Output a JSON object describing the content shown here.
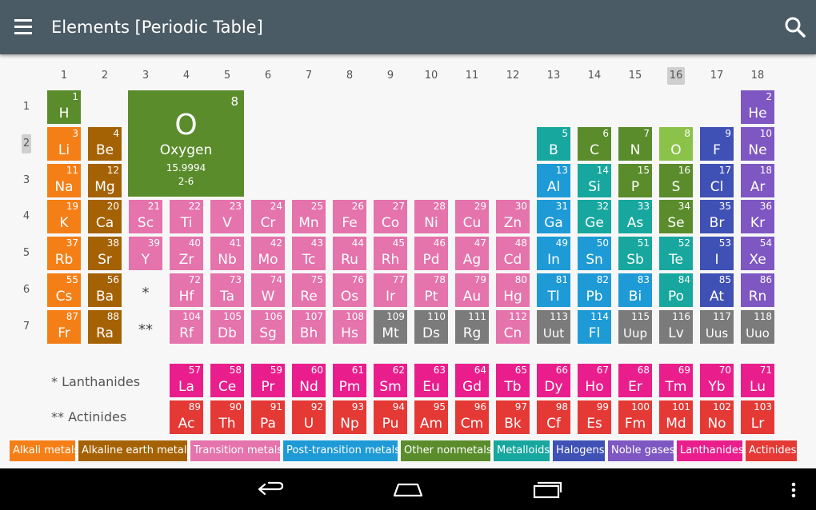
{
  "app_bar": {
    "title": "Elements [Periodic Table]",
    "menu_icon": "hamburger-menu-icon",
    "search_icon": "search-icon"
  },
  "groups": [
    "1",
    "2",
    "3",
    "4",
    "5",
    "6",
    "7",
    "8",
    "9",
    "10",
    "11",
    "12",
    "13",
    "14",
    "15",
    "16",
    "17",
    "18"
  ],
  "selected_group": "16",
  "periods": [
    "1",
    "2",
    "3",
    "4",
    "5",
    "6",
    "7"
  ],
  "selected_period": "2",
  "selected_element": {
    "number": "8",
    "symbol": "O",
    "name": "Oxygen",
    "mass": "15.9994",
    "config": "2-6",
    "color": "#5a8c2b"
  },
  "star_marks": {
    "lanthanide": "*",
    "actinide": "**"
  },
  "series_labels": {
    "lanthanides": "* Lanthanides",
    "actinides": "** Actinides"
  },
  "colors": {
    "alkali": "#f57f17",
    "alkaline": "#a56205",
    "transition": "#e573ac",
    "post": "#1e9ad6",
    "nonmetal": "#5a8c2b",
    "metalloid": "#17a79e",
    "halogen": "#3f51b5",
    "noble": "#7e57c2",
    "lanthanide": "#e91e8c",
    "actinide": "#e53935",
    "unknown": "#7b7b7b",
    "oxygen_cell": "#8bc34a"
  },
  "elements": [
    {
      "n": "1",
      "s": "H",
      "c": "nonmetal",
      "g": 1,
      "p": 1
    },
    {
      "n": "2",
      "s": "He",
      "c": "noble",
      "g": 18,
      "p": 1
    },
    {
      "n": "3",
      "s": "Li",
      "c": "alkali",
      "g": 1,
      "p": 2
    },
    {
      "n": "4",
      "s": "Be",
      "c": "alkaline",
      "g": 2,
      "p": 2
    },
    {
      "n": "5",
      "s": "B",
      "c": "metalloid",
      "g": 13,
      "p": 2
    },
    {
      "n": "6",
      "s": "C",
      "c": "nonmetal",
      "g": 14,
      "p": 2
    },
    {
      "n": "7",
      "s": "N",
      "c": "nonmetal",
      "g": 15,
      "p": 2
    },
    {
      "n": "8",
      "s": "O",
      "c": "oxygen_cell",
      "g": 16,
      "p": 2
    },
    {
      "n": "9",
      "s": "F",
      "c": "halogen",
      "g": 17,
      "p": 2
    },
    {
      "n": "10",
      "s": "Ne",
      "c": "noble",
      "g": 18,
      "p": 2
    },
    {
      "n": "11",
      "s": "Na",
      "c": "alkali",
      "g": 1,
      "p": 3
    },
    {
      "n": "12",
      "s": "Mg",
      "c": "alkaline",
      "g": 2,
      "p": 3
    },
    {
      "n": "13",
      "s": "Al",
      "c": "post",
      "g": 13,
      "p": 3
    },
    {
      "n": "14",
      "s": "Si",
      "c": "metalloid",
      "g": 14,
      "p": 3
    },
    {
      "n": "15",
      "s": "P",
      "c": "nonmetal",
      "g": 15,
      "p": 3
    },
    {
      "n": "16",
      "s": "S",
      "c": "nonmetal",
      "g": 16,
      "p": 3
    },
    {
      "n": "17",
      "s": "Cl",
      "c": "halogen",
      "g": 17,
      "p": 3
    },
    {
      "n": "18",
      "s": "Ar",
      "c": "noble",
      "g": 18,
      "p": 3
    },
    {
      "n": "19",
      "s": "K",
      "c": "alkali",
      "g": 1,
      "p": 4
    },
    {
      "n": "20",
      "s": "Ca",
      "c": "alkaline",
      "g": 2,
      "p": 4
    },
    {
      "n": "21",
      "s": "Sc",
      "c": "transition",
      "g": 3,
      "p": 4
    },
    {
      "n": "22",
      "s": "Ti",
      "c": "transition",
      "g": 4,
      "p": 4
    },
    {
      "n": "23",
      "s": "V",
      "c": "transition",
      "g": 5,
      "p": 4
    },
    {
      "n": "24",
      "s": "Cr",
      "c": "transition",
      "g": 6,
      "p": 4
    },
    {
      "n": "25",
      "s": "Mn",
      "c": "transition",
      "g": 7,
      "p": 4
    },
    {
      "n": "26",
      "s": "Fe",
      "c": "transition",
      "g": 8,
      "p": 4
    },
    {
      "n": "27",
      "s": "Co",
      "c": "transition",
      "g": 9,
      "p": 4
    },
    {
      "n": "28",
      "s": "Ni",
      "c": "transition",
      "g": 10,
      "p": 4
    },
    {
      "n": "29",
      "s": "Cu",
      "c": "transition",
      "g": 11,
      "p": 4
    },
    {
      "n": "30",
      "s": "Zn",
      "c": "transition",
      "g": 12,
      "p": 4
    },
    {
      "n": "31",
      "s": "Ga",
      "c": "post",
      "g": 13,
      "p": 4
    },
    {
      "n": "32",
      "s": "Ge",
      "c": "metalloid",
      "g": 14,
      "p": 4
    },
    {
      "n": "33",
      "s": "As",
      "c": "metalloid",
      "g": 15,
      "p": 4
    },
    {
      "n": "34",
      "s": "Se",
      "c": "nonmetal",
      "g": 16,
      "p": 4
    },
    {
      "n": "35",
      "s": "Br",
      "c": "halogen",
      "g": 17,
      "p": 4
    },
    {
      "n": "36",
      "s": "Kr",
      "c": "noble",
      "g": 18,
      "p": 4
    },
    {
      "n": "37",
      "s": "Rb",
      "c": "alkali",
      "g": 1,
      "p": 5
    },
    {
      "n": "38",
      "s": "Sr",
      "c": "alkaline",
      "g": 2,
      "p": 5
    },
    {
      "n": "39",
      "s": "Y",
      "c": "transition",
      "g": 3,
      "p": 5
    },
    {
      "n": "40",
      "s": "Zr",
      "c": "transition",
      "g": 4,
      "p": 5
    },
    {
      "n": "41",
      "s": "Nb",
      "c": "transition",
      "g": 5,
      "p": 5
    },
    {
      "n": "42",
      "s": "Mo",
      "c": "transition",
      "g": 6,
      "p": 5
    },
    {
      "n": "43",
      "s": "Tc",
      "c": "transition",
      "g": 7,
      "p": 5
    },
    {
      "n": "44",
      "s": "Ru",
      "c": "transition",
      "g": 8,
      "p": 5
    },
    {
      "n": "45",
      "s": "Rh",
      "c": "transition",
      "g": 9,
      "p": 5
    },
    {
      "n": "46",
      "s": "Pd",
      "c": "transition",
      "g": 10,
      "p": 5
    },
    {
      "n": "47",
      "s": "Ag",
      "c": "transition",
      "g": 11,
      "p": 5
    },
    {
      "n": "48",
      "s": "Cd",
      "c": "transition",
      "g": 12,
      "p": 5
    },
    {
      "n": "49",
      "s": "In",
      "c": "post",
      "g": 13,
      "p": 5
    },
    {
      "n": "50",
      "s": "Sn",
      "c": "post",
      "g": 14,
      "p": 5
    },
    {
      "n": "51",
      "s": "Sb",
      "c": "metalloid",
      "g": 15,
      "p": 5
    },
    {
      "n": "52",
      "s": "Te",
      "c": "metalloid",
      "g": 16,
      "p": 5
    },
    {
      "n": "53",
      "s": "I",
      "c": "halogen",
      "g": 17,
      "p": 5
    },
    {
      "n": "54",
      "s": "Xe",
      "c": "noble",
      "g": 18,
      "p": 5
    },
    {
      "n": "55",
      "s": "Cs",
      "c": "alkali",
      "g": 1,
      "p": 6
    },
    {
      "n": "56",
      "s": "Ba",
      "c": "alkaline",
      "g": 2,
      "p": 6
    },
    {
      "n": "72",
      "s": "Hf",
      "c": "transition",
      "g": 4,
      "p": 6
    },
    {
      "n": "73",
      "s": "Ta",
      "c": "transition",
      "g": 5,
      "p": 6
    },
    {
      "n": "74",
      "s": "W",
      "c": "transition",
      "g": 6,
      "p": 6
    },
    {
      "n": "75",
      "s": "Re",
      "c": "transition",
      "g": 7,
      "p": 6
    },
    {
      "n": "76",
      "s": "Os",
      "c": "transition",
      "g": 8,
      "p": 6
    },
    {
      "n": "77",
      "s": "Ir",
      "c": "transition",
      "g": 9,
      "p": 6
    },
    {
      "n": "78",
      "s": "Pt",
      "c": "transition",
      "g": 10,
      "p": 6
    },
    {
      "n": "79",
      "s": "Au",
      "c": "transition",
      "g": 11,
      "p": 6
    },
    {
      "n": "80",
      "s": "Hg",
      "c": "transition",
      "g": 12,
      "p": 6
    },
    {
      "n": "81",
      "s": "Tl",
      "c": "post",
      "g": 13,
      "p": 6
    },
    {
      "n": "82",
      "s": "Pb",
      "c": "post",
      "g": 14,
      "p": 6
    },
    {
      "n": "83",
      "s": "Bi",
      "c": "post",
      "g": 15,
      "p": 6
    },
    {
      "n": "84",
      "s": "Po",
      "c": "metalloid",
      "g": 16,
      "p": 6
    },
    {
      "n": "85",
      "s": "At",
      "c": "halogen",
      "g": 17,
      "p": 6
    },
    {
      "n": "86",
      "s": "Rn",
      "c": "noble",
      "g": 18,
      "p": 6
    },
    {
      "n": "87",
      "s": "Fr",
      "c": "alkali",
      "g": 1,
      "p": 7
    },
    {
      "n": "88",
      "s": "Ra",
      "c": "alkaline",
      "g": 2,
      "p": 7
    },
    {
      "n": "104",
      "s": "Rf",
      "c": "transition",
      "g": 4,
      "p": 7
    },
    {
      "n": "105",
      "s": "Db",
      "c": "transition",
      "g": 5,
      "p": 7
    },
    {
      "n": "106",
      "s": "Sg",
      "c": "transition",
      "g": 6,
      "p": 7
    },
    {
      "n": "107",
      "s": "Bh",
      "c": "transition",
      "g": 7,
      "p": 7
    },
    {
      "n": "108",
      "s": "Hs",
      "c": "transition",
      "g": 8,
      "p": 7
    },
    {
      "n": "109",
      "s": "Mt",
      "c": "unknown",
      "g": 9,
      "p": 7
    },
    {
      "n": "110",
      "s": "Ds",
      "c": "unknown",
      "g": 10,
      "p": 7
    },
    {
      "n": "111",
      "s": "Rg",
      "c": "unknown",
      "g": 11,
      "p": 7
    },
    {
      "n": "112",
      "s": "Cn",
      "c": "transition",
      "g": 12,
      "p": 7
    },
    {
      "n": "113",
      "s": "Uut",
      "c": "unknown",
      "g": 13,
      "p": 7
    },
    {
      "n": "114",
      "s": "Fl",
      "c": "post",
      "g": 14,
      "p": 7
    },
    {
      "n": "115",
      "s": "Uup",
      "c": "unknown",
      "g": 15,
      "p": 7
    },
    {
      "n": "116",
      "s": "Lv",
      "c": "unknown",
      "g": 16,
      "p": 7
    },
    {
      "n": "117",
      "s": "Uus",
      "c": "unknown",
      "g": 17,
      "p": 7
    },
    {
      "n": "118",
      "s": "Uuo",
      "c": "unknown",
      "g": 18,
      "p": 7
    }
  ],
  "lanthanides": [
    {
      "n": "57",
      "s": "La"
    },
    {
      "n": "58",
      "s": "Ce"
    },
    {
      "n": "59",
      "s": "Pr"
    },
    {
      "n": "60",
      "s": "Nd"
    },
    {
      "n": "61",
      "s": "Pm"
    },
    {
      "n": "62",
      "s": "Sm"
    },
    {
      "n": "63",
      "s": "Eu"
    },
    {
      "n": "64",
      "s": "Gd"
    },
    {
      "n": "65",
      "s": "Tb"
    },
    {
      "n": "66",
      "s": "Dy"
    },
    {
      "n": "67",
      "s": "Ho"
    },
    {
      "n": "68",
      "s": "Er"
    },
    {
      "n": "69",
      "s": "Tm"
    },
    {
      "n": "70",
      "s": "Yb"
    },
    {
      "n": "71",
      "s": "Lu"
    }
  ],
  "actinides": [
    {
      "n": "89",
      "s": "Ac"
    },
    {
      "n": "90",
      "s": "Th"
    },
    {
      "n": "91",
      "s": "Pa"
    },
    {
      "n": "92",
      "s": "U"
    },
    {
      "n": "93",
      "s": "Np"
    },
    {
      "n": "94",
      "s": "Pu"
    },
    {
      "n": "95",
      "s": "Am"
    },
    {
      "n": "96",
      "s": "Cm"
    },
    {
      "n": "97",
      "s": "Bk"
    },
    {
      "n": "98",
      "s": "Cf"
    },
    {
      "n": "99",
      "s": "Es"
    },
    {
      "n": "100",
      "s": "Fm"
    },
    {
      "n": "101",
      "s": "Md"
    },
    {
      "n": "102",
      "s": "No"
    },
    {
      "n": "103",
      "s": "Lr"
    }
  ],
  "legend": [
    {
      "label": "Alkali metals",
      "c": "alkali"
    },
    {
      "label": "Alkaline earth metals",
      "c": "alkaline"
    },
    {
      "label": "Transition metals",
      "c": "transition"
    },
    {
      "label": "Post-transition metals",
      "c": "post"
    },
    {
      "label": "Other nonmetals",
      "c": "nonmetal"
    },
    {
      "label": "Metalloids",
      "c": "metalloid"
    },
    {
      "label": "Halogens",
      "c": "halogen"
    },
    {
      "label": "Noble gases",
      "c": "noble"
    },
    {
      "label": "Lanthanides",
      "c": "lanthanide"
    },
    {
      "label": "Actinides",
      "c": "actinide"
    }
  ],
  "nav_bar": {
    "back_icon": "back-icon",
    "home_icon": "home-icon",
    "recents_icon": "recent-apps-icon",
    "overflow_icon": "overflow-menu-icon"
  }
}
